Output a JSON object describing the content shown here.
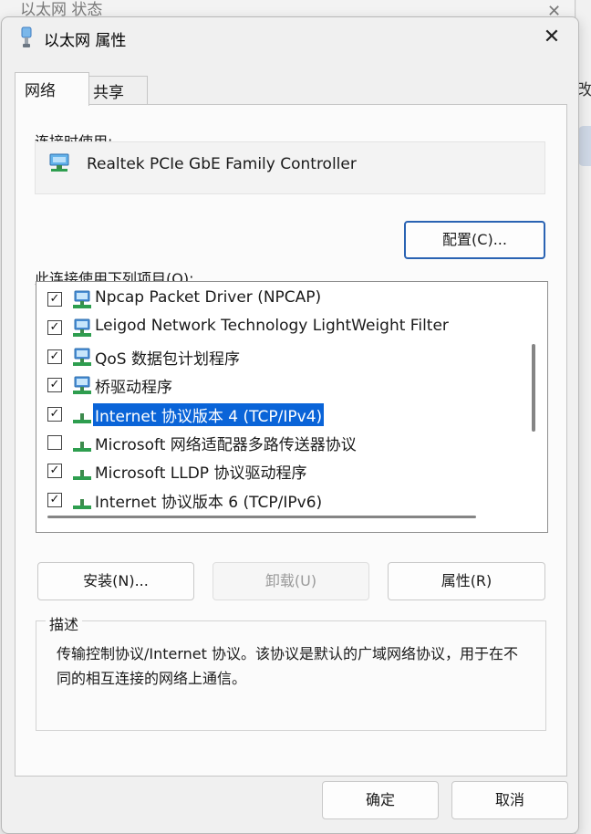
{
  "background_window": {
    "title": "以太网 状态",
    "right_partial_text": "改"
  },
  "dialog": {
    "title": "以太网 属性",
    "icons": {
      "title": "network-adapter-icon",
      "close": "close-icon"
    }
  },
  "tabs": [
    {
      "label": "网络",
      "active": true
    },
    {
      "label": "共享",
      "active": false
    }
  ],
  "connect_using_label": "连接时使用:",
  "adapter_name": "Realtek PCIe GbE Family Controller",
  "configure_button": "配置(C)...",
  "items_label": "此连接使用下列项目(O):",
  "items": [
    {
      "label": "Npcap Packet Driver (NPCAP)",
      "checked": true,
      "icon": "network-client-icon"
    },
    {
      "label": "Leigod Network Technology LightWeight Filter",
      "checked": true,
      "icon": "network-client-icon"
    },
    {
      "label": "QoS 数据包计划程序",
      "checked": true,
      "icon": "network-client-icon"
    },
    {
      "label": "桥驱动程序",
      "checked": true,
      "icon": "network-client-icon"
    },
    {
      "label": "Internet 协议版本 4 (TCP/IPv4)",
      "checked": true,
      "icon": "protocol-icon",
      "selected": true
    },
    {
      "label": "Microsoft 网络适配器多路传送器协议",
      "checked": false,
      "icon": "protocol-icon"
    },
    {
      "label": "Microsoft LLDP 协议驱动程序",
      "checked": true,
      "icon": "protocol-icon"
    },
    {
      "label": "Internet 协议版本 6 (TCP/IPv6)",
      "checked": true,
      "icon": "protocol-icon"
    }
  ],
  "buttons": {
    "install": "安装(N)...",
    "uninstall": "卸载(U)",
    "properties": "属性(R)",
    "ok": "确定",
    "cancel": "取消"
  },
  "description": {
    "title": "描述",
    "text": "传输控制协议/Internet 协议。该协议是默认的广域网络协议，用于在不同的相互连接的网络上通信。"
  },
  "colors": {
    "selection": "#0a64d8",
    "default_button_border": "#2a63b3",
    "icon_green": "#2e9e4f",
    "icon_blue": "#4a8fd6"
  }
}
